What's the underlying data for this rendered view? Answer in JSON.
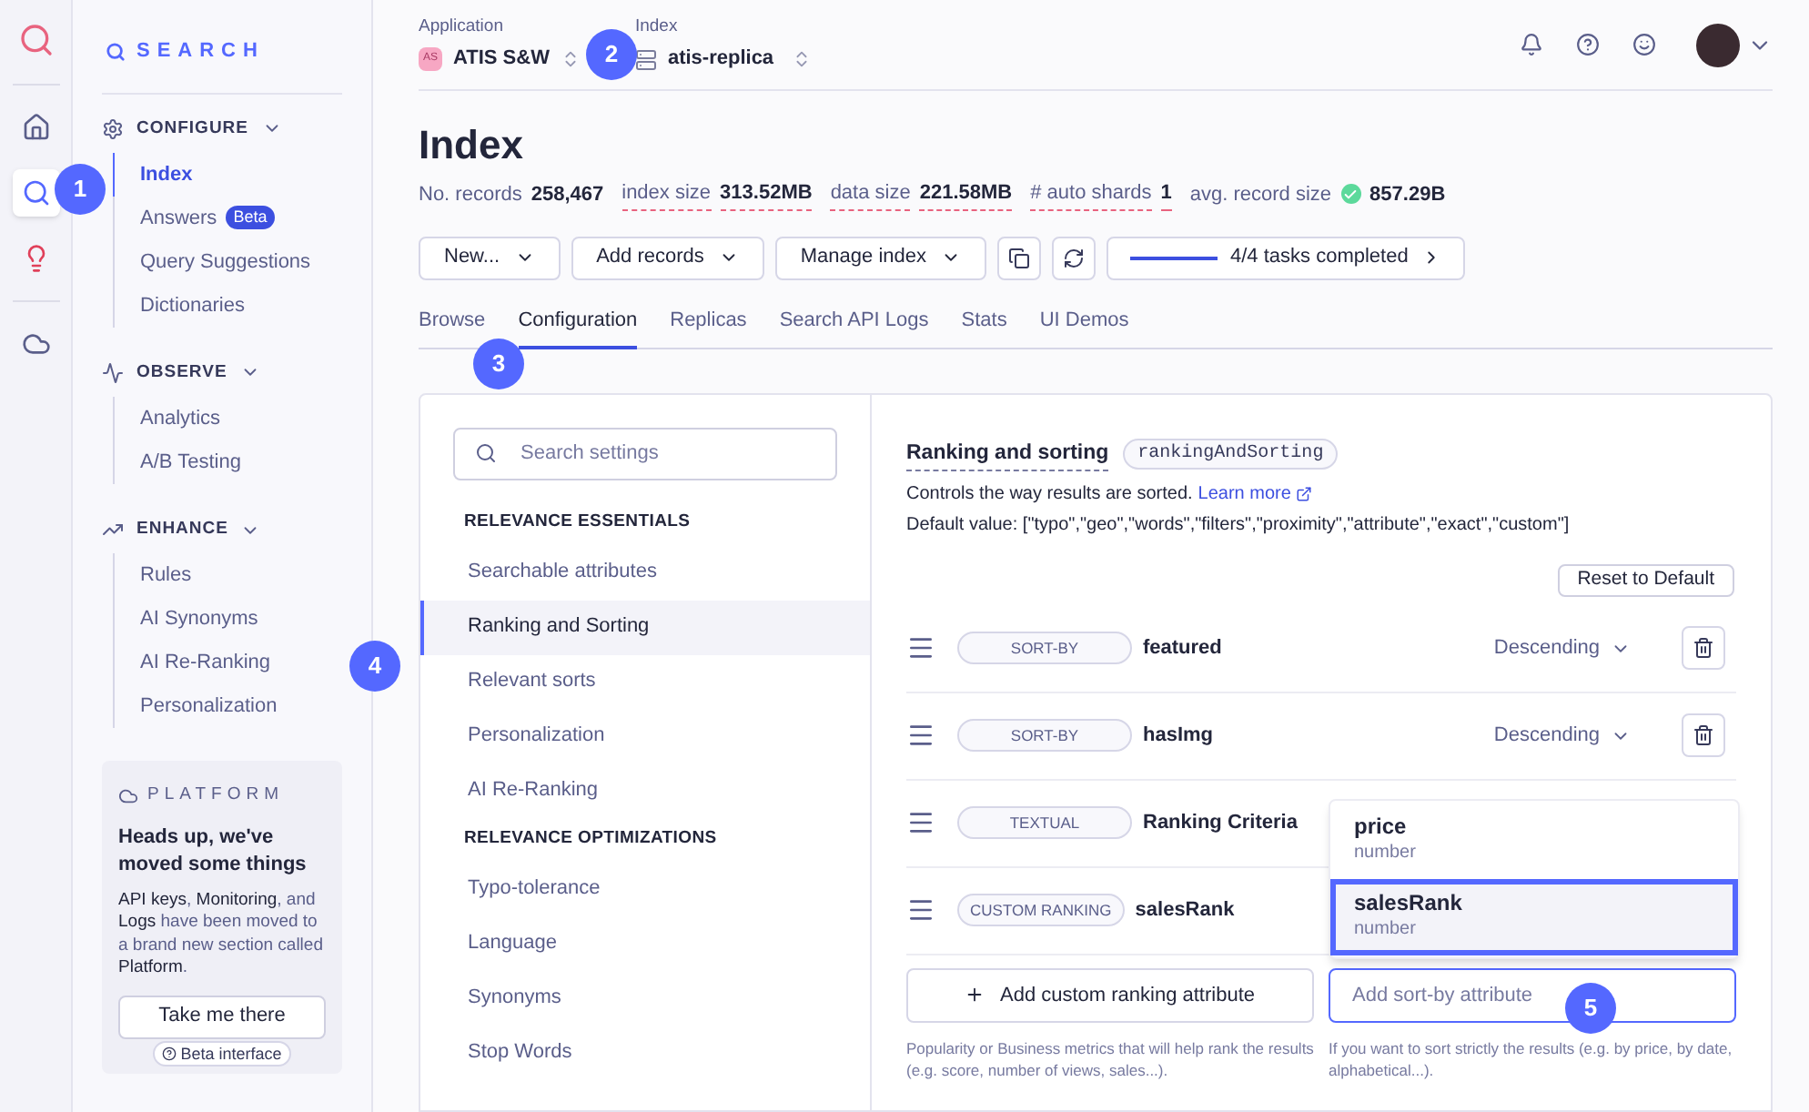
{
  "rail": [
    {
      "selected": false
    },
    {
      "selected": true
    },
    {
      "selected": false
    },
    {
      "selected": false
    }
  ],
  "sidebar": {
    "brand": "SEARCH",
    "sections": [
      {
        "title": "CONFIGURE",
        "items": [
          {
            "label": "Index",
            "selected": true
          },
          {
            "label": "Answers",
            "badge": "Beta",
            "selected": false
          },
          {
            "label": "Query Suggestions",
            "selected": false
          },
          {
            "label": "Dictionaries",
            "selected": false
          }
        ]
      },
      {
        "title": "OBSERVE",
        "items": [
          {
            "label": "Analytics",
            "selected": false
          },
          {
            "label": "A/B Testing",
            "selected": false
          }
        ]
      },
      {
        "title": "ENHANCE",
        "items": [
          {
            "label": "Rules",
            "selected": false
          },
          {
            "label": "AI Synonyms",
            "selected": false
          },
          {
            "label": "AI Re-Ranking",
            "selected": false
          },
          {
            "label": "Personalization",
            "selected": false
          }
        ]
      }
    ],
    "platform": {
      "brand": "PLATFORM",
      "heading": "Heads up, we've moved some things",
      "body": "**API keys**, **Monitoring**, and **Logs** have been moved to a brand new section called **Platform**.",
      "button": "Take me there",
      "footer": "Beta interface"
    }
  },
  "header": {
    "app_label": "Application",
    "app_badge": "AS",
    "app_name": "ATIS S&W",
    "index_label": "Index",
    "index_name": "atis-replica"
  },
  "page": {
    "title": "Index",
    "stats": [
      {
        "label": "No. records",
        "value": "258,467",
        "underlined": false
      },
      {
        "label": "index size",
        "value": "313.52MB",
        "underlined": true
      },
      {
        "label": "data size",
        "value": "221.58MB",
        "underlined": true
      },
      {
        "label": "# auto shards",
        "value": "1",
        "underlined": true
      },
      {
        "label": "avg. record size",
        "value": "857.29B",
        "underlined": false,
        "verified": true
      }
    ]
  },
  "toolbar": {
    "buttons": [
      {
        "kind": "menu",
        "label": "New..."
      },
      {
        "kind": "menu",
        "label": "Add records"
      },
      {
        "kind": "menu",
        "label": "Manage index"
      },
      {
        "kind": "icon"
      },
      {
        "kind": "icon"
      }
    ],
    "tasks": {
      "label": "4/4 tasks completed",
      "level": 1
    }
  },
  "tabs": [
    {
      "label": "Browse",
      "selected": false
    },
    {
      "label": "Configuration",
      "selected": true
    },
    {
      "label": "Replicas",
      "selected": false
    },
    {
      "label": "Search API Logs",
      "selected": false
    },
    {
      "label": "Stats",
      "selected": false
    },
    {
      "label": "UI Demos",
      "selected": false
    }
  ],
  "settings_nav": {
    "placeholder": "Search settings",
    "groups": [
      {
        "title": "RELEVANCE ESSENTIALS",
        "items": [
          {
            "label": "Searchable attributes",
            "selected": false
          },
          {
            "label": "Ranking and Sorting",
            "selected": true
          },
          {
            "label": "Relevant sorts",
            "selected": false
          },
          {
            "label": "Personalization",
            "selected": false
          },
          {
            "label": "AI Re-Ranking",
            "selected": false
          }
        ]
      },
      {
        "title": "RELEVANCE OPTIMIZATIONS",
        "items": [
          {
            "label": "Typo-tolerance",
            "selected": false
          },
          {
            "label": "Language",
            "selected": false
          },
          {
            "label": "Synonyms",
            "selected": false
          },
          {
            "label": "Stop Words",
            "selected": false
          }
        ]
      }
    ]
  },
  "setting": {
    "title": "Ranking and sorting",
    "code": "rankingAndSorting",
    "description": "Controls the way results are sorted.",
    "link": "Learn more",
    "default_value": "Default value: [\"typo\",\"geo\",\"words\",\"filters\",\"proximity\",\"attribute\",\"exact\",\"custom\"]",
    "reset_button": "Reset to Default",
    "rules": [
      {
        "tag": "SORT-BY",
        "name": "featured",
        "order": "Descending"
      },
      {
        "tag": "SORT-BY",
        "name": "hasImg",
        "order": "Descending"
      },
      {
        "tag": "TEXTUAL",
        "name": "Ranking Criteria"
      },
      {
        "tag": "CUSTOM RANKING",
        "name": "salesRank"
      }
    ],
    "suggestions": [
      {
        "name": "price",
        "type": "number",
        "selected": false
      },
      {
        "name": "salesRank",
        "type": "number",
        "selected": true
      }
    ],
    "add_button": "Add custom ranking attribute",
    "input_placeholder": "Add sort-by attribute",
    "help_left": "Popularity or Business metrics that will help rank the results (e.g. score, number of views, sales...).",
    "help_right": "If you want to sort strictly the results (e.g. by price, by date, alphabetical...)."
  },
  "callouts": [
    "1",
    "2",
    "3",
    "4",
    "5"
  ]
}
